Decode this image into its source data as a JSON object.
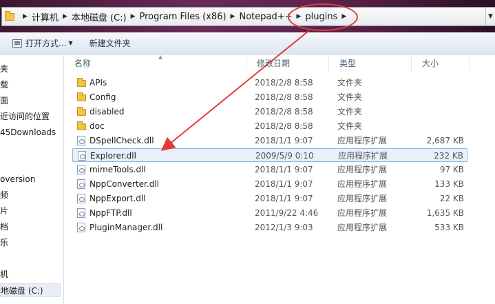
{
  "address": {
    "crumbs": [
      "计算机",
      "本地磁盘 (C:)",
      "Program Files (x86)",
      "Notepad++",
      "plugins"
    ]
  },
  "toolbar": {
    "open_with_label": "打开方式...",
    "new_folder_label": "新建文件夹"
  },
  "nav": {
    "items": [
      "夹",
      "载",
      "面",
      "近访问的位置",
      "45Downloads",
      "oversion",
      "频",
      "片",
      "档",
      "乐",
      "机",
      "地磁盘 (C:)"
    ]
  },
  "columns": {
    "name": "名称",
    "date": "修改日期",
    "type": "类型",
    "size": "大小"
  },
  "files": [
    {
      "name": "APIs",
      "date": "2018/2/8 8:58",
      "type": "文件夹",
      "size": "",
      "kind": "folder"
    },
    {
      "name": "Config",
      "date": "2018/2/8 8:58",
      "type": "文件夹",
      "size": "",
      "kind": "folder"
    },
    {
      "name": "disabled",
      "date": "2018/2/8 8:58",
      "type": "文件夹",
      "size": "",
      "kind": "folder"
    },
    {
      "name": "doc",
      "date": "2018/2/8 8:58",
      "type": "文件夹",
      "size": "",
      "kind": "folder"
    },
    {
      "name": "DSpellCheck.dll",
      "date": "2018/1/1 9:07",
      "type": "应用程序扩展",
      "size": "2,687 KB",
      "kind": "dll"
    },
    {
      "name": "Explorer.dll",
      "date": "2009/5/9 0:10",
      "type": "应用程序扩展",
      "size": "232 KB",
      "kind": "dll"
    },
    {
      "name": "mimeTools.dll",
      "date": "2018/1/1 9:07",
      "type": "应用程序扩展",
      "size": "97 KB",
      "kind": "dll"
    },
    {
      "name": "NppConverter.dll",
      "date": "2018/1/1 9:07",
      "type": "应用程序扩展",
      "size": "133 KB",
      "kind": "dll"
    },
    {
      "name": "NppExport.dll",
      "date": "2018/1/1 9:07",
      "type": "应用程序扩展",
      "size": "22 KB",
      "kind": "dll"
    },
    {
      "name": "NppFTP.dll",
      "date": "2011/9/22 4:46",
      "type": "应用程序扩展",
      "size": "1,635 KB",
      "kind": "dll"
    },
    {
      "name": "PluginManager.dll",
      "date": "2012/1/3 9:03",
      "type": "应用程序扩展",
      "size": "533 KB",
      "kind": "dll"
    }
  ],
  "colors": {
    "annotation": "#e23a3a",
    "highlight_border": "#8fb2e0"
  }
}
